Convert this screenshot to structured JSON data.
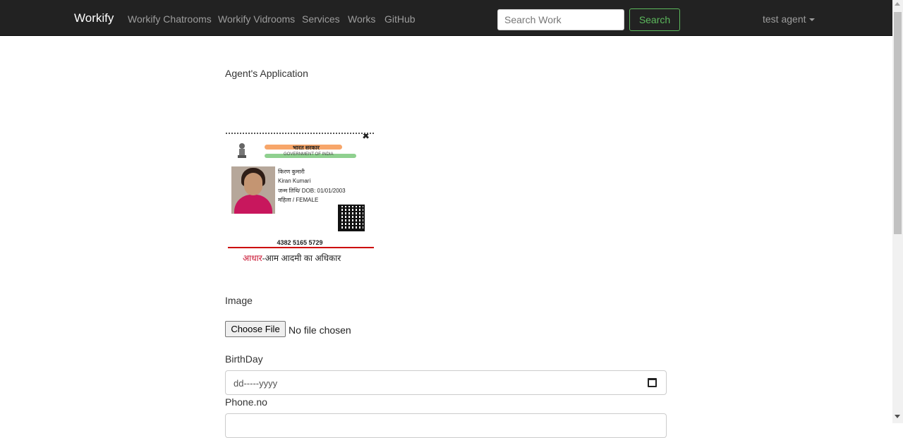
{
  "navbar": {
    "brand": "Workify",
    "links": [
      "Workify Chatrooms",
      "Workify Vidrooms",
      "Services",
      "Works",
      "GitHub"
    ],
    "search_placeholder": "Search Work",
    "search_button": "Search",
    "user": "test agent"
  },
  "main": {
    "heading": "Agent's Application",
    "id_card": {
      "header_hindi": "भारत सरकार",
      "header_english": "GOVERNMENT OF INDIA",
      "name_hindi": "किरण कुमारी",
      "name": "Kiran Kumari",
      "dob": "जन्म तिथि/ DOB: 01/01/2003",
      "gender": "महिला / FEMALE",
      "number": "4382 5165 5729",
      "footer_red": "आधार",
      "footer_rest": "-आम आदमी का अधिकार"
    },
    "image_label": "Image",
    "choose_file_button": "Choose File",
    "no_file_text": "No file chosen",
    "birthday_label": "BirthDay",
    "birthday_placeholder": "dd-----yyyy",
    "phone_label": "Phone.no"
  },
  "colors": {
    "navbar_bg": "#222222",
    "nav_link": "#9d9d9d",
    "search_button": "#5cb85c"
  }
}
